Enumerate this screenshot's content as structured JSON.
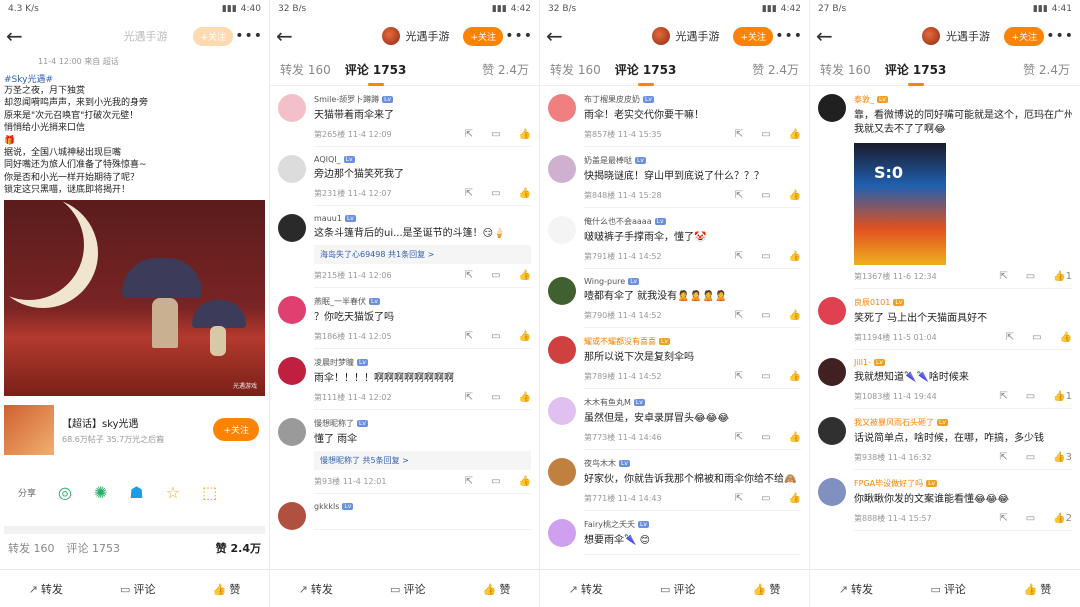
{
  "panels": [
    {
      "status": {
        "left": "4.3 K/s",
        "right": "4:40"
      },
      "nav": {
        "title": "光遇手游",
        "follow": "+关注"
      },
      "post": {
        "header": "11-4 12:00  来自 超话",
        "tag": "#Sky光遇#",
        "lines": [
          "万圣之夜，月下独赏",
          "却忽闻嗬鸣声声，来到小光我的身旁",
          "原来是\"次元召唤官\"打破次元壁！",
          "悄悄给小光捎来口信",
          "🎁",
          "据说，全国八城神秘出现巨嘴",
          "同好嘴还为旅人们准备了特殊惊喜~",
          "你是否和小光一样开始期待了呢？",
          "锁定这只黑喵，谜底即将揭开！"
        ],
        "watermark": "光遇游戏",
        "card": {
          "title": "【超话】sky光遇",
          "sub": "68.6万帖子  35.7万光之后裔",
          "follow": "+关注"
        },
        "share_label": "分享",
        "stats": {
          "repost": "转发 160",
          "comment": "评论 1753",
          "like": "赞 2.4万"
        }
      },
      "bar": {
        "repost": "转发",
        "comment": "评论",
        "like": "赞"
      }
    },
    {
      "status": {
        "left": "32 B/s",
        "right": "4:42"
      },
      "nav": {
        "title": "光遇手游",
        "follow": "+关注"
      },
      "tabs": {
        "repost": "转发 160",
        "comment": "评论 1753",
        "like": "赞 2.4万"
      },
      "comments": [
        {
          "name": "Smile-颉罗卜蹲蹲",
          "text": "天猫带着雨伞来了",
          "meta": "第265楼  11-4 12:09",
          "color": "#f4c0c8"
        },
        {
          "name": "AQIQI_",
          "text": "旁边那个猫笑死我了",
          "meta": "第231楼  11-4 12:07",
          "color": "#dcdcdc"
        },
        {
          "name": "mauu1",
          "text": "这条斗篷背后的ui...是圣诞节的斗篷！😏🍦",
          "meta": "第215楼  11-4 12:06",
          "color": "#2a2a2a",
          "reply": "海岛失了心69498  共1条回复  >"
        },
        {
          "name": "燕眠_一半春伏",
          "text": "？你吃天猫饭了吗",
          "meta": "第186楼  11-4 12:05",
          "color": "#e04070"
        },
        {
          "name": "凌晨时梦瞳",
          "text": "雨伞！！！！啊啊啊啊啊啊啊啊",
          "meta": "第111楼  11-4 12:02",
          "color": "#c02040"
        },
        {
          "name": "慢想昵称了",
          "text": "懂了 雨伞",
          "meta": "第93楼  11-4 12:01",
          "color": "#9a9a9a",
          "reply": "慢想昵称了  共5条回复  >"
        },
        {
          "name": "gkkkls",
          "text": "",
          "meta": "",
          "color": "#b05040"
        }
      ],
      "bar": {
        "repost": "转发",
        "comment": "评论",
        "like": "赞"
      }
    },
    {
      "status": {
        "left": "32 B/s",
        "right": "4:42"
      },
      "nav": {
        "title": "光遇手游",
        "follow": "+关注"
      },
      "tabs": {
        "repost": "转发 160",
        "comment": "评论 1753",
        "like": "赞 2.4万"
      },
      "comments": [
        {
          "name": "布丁榴果皮皮奶",
          "text": "雨伞！老实交代你要干嘛！",
          "meta": "第857楼  11-4 15:35",
          "color": "#f08080"
        },
        {
          "name": "奶盖是最棒哒",
          "text": "快揭晓谜底！穿山甲到底说了什么？？？",
          "meta": "第848楼  11-4 15:28",
          "color": "#d0b0d0"
        },
        {
          "name": "俺什么也不会aaaa",
          "text": "啵啵裤子手撑雨伞，懂了🤡",
          "meta": "第791楼  11-4 14:52",
          "color": "#f4f4f4"
        },
        {
          "name": "Wing-pure",
          "text": "噎都有伞了 就我没有🙎🙎🙎🙎",
          "meta": "第790楼  11-4 14:52",
          "color": "#406030"
        },
        {
          "name": "耀或不耀都没有喜喜",
          "text": "那所以说下次是复刻伞吗",
          "meta": "第789楼  11-4 14:52",
          "color": "#d04040",
          "orange": true
        },
        {
          "name": "木木有鱼丸M",
          "text": "虽然但是，安卓录屏冒头😂😂😂",
          "meta": "第773楼  11-4 14:46",
          "color": "#e0c0f0"
        },
        {
          "name": "夜鸟木木",
          "text": "好家伙，你就告诉我那个棉被和雨伞你给不给🙈",
          "meta": "第771楼  11-4 14:43",
          "color": "#c08040"
        },
        {
          "name": "Fairy桃之夭夭",
          "text": "想要雨伞🌂 😊",
          "meta": "",
          "color": "#d0a0f0"
        }
      ],
      "bar": {
        "repost": "转发",
        "comment": "评论",
        "like": "赞"
      }
    },
    {
      "status": {
        "left": "27 B/s",
        "right": "4:41"
      },
      "nav": {
        "title": "光遇手游",
        "follow": "+关注"
      },
      "tabs": {
        "repost": "转发 160",
        "comment": "评论 1753",
        "like": "赞 2.4万"
      },
      "comments": [
        {
          "name": "泰敦_",
          "text": "靠，看微博说的同好嘴可能就是这个，厄玛在广州",
          "text2": "我就又去不了了啊😂",
          "meta": "第1367楼  11-6 12:34",
          "color": "#202020",
          "orange": true,
          "poster": true,
          "likes": "1"
        },
        {
          "name": "良辰0101",
          "text": "笑死了 马上出个天猫面具好不",
          "meta": "第1194楼  11-5 01:04",
          "color": "#e04050",
          "orange": true,
          "likes": ""
        },
        {
          "name": "Jill1-",
          "text": "我就想知道🌂🌂啥时候来",
          "meta": "第1083楼  11-4 19:44",
          "color": "#402020",
          "orange": true,
          "likes": "1"
        },
        {
          "name": "我又被暴风雨石头砸了",
          "text": "话说简单点，啥时候，在哪，咋搞，多少钱",
          "meta": "第938楼  11-4 16:32",
          "color": "#303030",
          "orange": true,
          "likes": "3"
        },
        {
          "name": "FPGA毕设做好了吗",
          "text": "你瞅瞅你发的文案谁能看懂😂😂😂",
          "meta": "第888楼  11-4 15:57",
          "color": "#8090c0",
          "orange": true,
          "likes": "2"
        }
      ],
      "bar": {
        "repost": "转发",
        "comment": "评论",
        "like": "赞"
      }
    }
  ]
}
